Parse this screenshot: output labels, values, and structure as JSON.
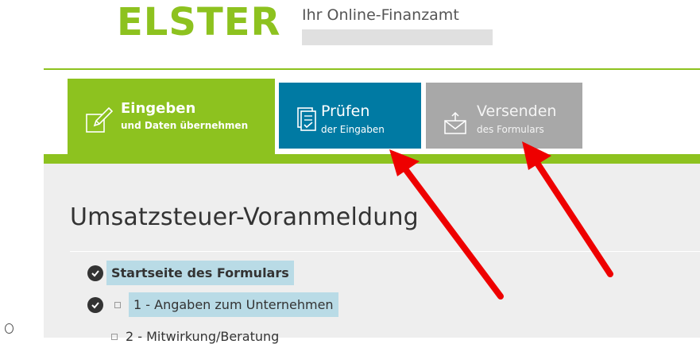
{
  "brand": {
    "logo_text": "ELSTER",
    "tagline": "Ihr Online-Finanzamt"
  },
  "tabs": [
    {
      "title": "Eingeben",
      "subtitle": "und Daten übernehmen",
      "icon": "edit-icon",
      "color": "#8dc21f",
      "active": true
    },
    {
      "title": "Prüfen",
      "subtitle": "der Eingaben",
      "icon": "checklist-icon",
      "color": "#007aa3"
    },
    {
      "title": "Versenden",
      "subtitle": "des Formulars",
      "icon": "send-envelope-icon",
      "color": "#a8a8a8"
    }
  ],
  "page": {
    "title": "Umsatzsteuer-Voranmeldung"
  },
  "form_nav": [
    {
      "label": "Startseite des Formulars",
      "complete": true
    },
    {
      "label": "1 - Angaben zum Unternehmen",
      "complete": true
    },
    {
      "label": "2 - Mitwirkung/Beratung",
      "complete": false
    }
  ],
  "colors": {
    "accent_green": "#8dc21f",
    "annotation_red": "#ee0000",
    "nav_highlight": "#b9dbe6"
  }
}
